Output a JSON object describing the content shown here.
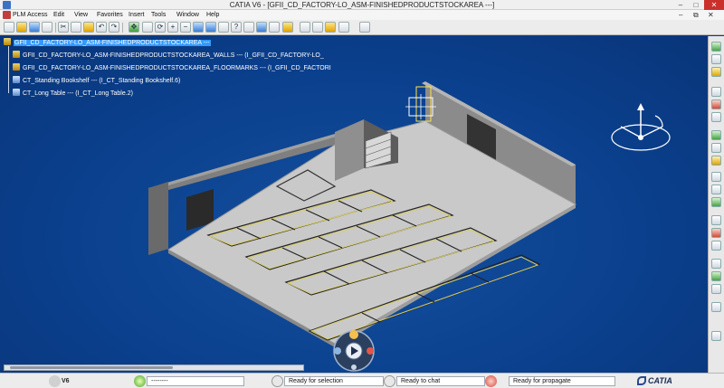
{
  "window": {
    "title": "CATIA V6 - [GFII_CD_FACTORY-LO_ASM-FINISHEDPRODUCTSTOCKAREA ---]"
  },
  "menu": {
    "items": [
      "PLM Access",
      "Edit",
      "View",
      "Favorites",
      "Insert",
      "Tools",
      "Window",
      "Help"
    ]
  },
  "tree": {
    "root": "GFII_CD_FACTORY-LO_ASM-FINISHEDPRODUCTSTOCKAREA ---",
    "children": [
      "GFII_CD_FACTORY-LO_ASM-FINISHEDPRODUCTSTOCKAREA_WALLS --- (I_GFII_CD_FACTORY-LO_",
      "GFII_CD_FACTORY-LO_ASM-FINISHEDPRODUCTSTOCKAREA_FLOORMARKS --- (I_GFII_CD_FACTORI",
      "CT_Standing Bookshelf --- (I_CT_Standing Bookshelf.6)",
      "CT_Long Table --- (I_CT_Long Table.2)"
    ]
  },
  "status": {
    "app_label": "V6",
    "command_value": "--------",
    "selection": "Ready for selection",
    "chat": "Ready to chat",
    "propagate": "Ready for propagate",
    "brand": "CATIA"
  },
  "colors": {
    "background": "#0a3d8f",
    "selection_highlight": "#3399ff",
    "floor": "#c9c9c9",
    "wall": "#8d8d8d",
    "floor_marks": "#d7cc6a"
  },
  "icons": {
    "toolbar": [
      "new-icon",
      "open-icon",
      "save-icon",
      "print-icon",
      "cut-icon",
      "copy-icon",
      "paste-icon",
      "undo-icon",
      "redo-icon",
      "pan-icon",
      "rotate-icon",
      "zoom-in-icon",
      "zoom-out-icon",
      "normal-view-icon",
      "multi-view-icon",
      "iso-view-icon",
      "shading-icon",
      "hide-show-icon",
      "swap-visible-icon",
      "help-icon",
      "folder-icon",
      "material-icon",
      "lock-icon",
      "tree-icon",
      "camera-icon"
    ]
  }
}
